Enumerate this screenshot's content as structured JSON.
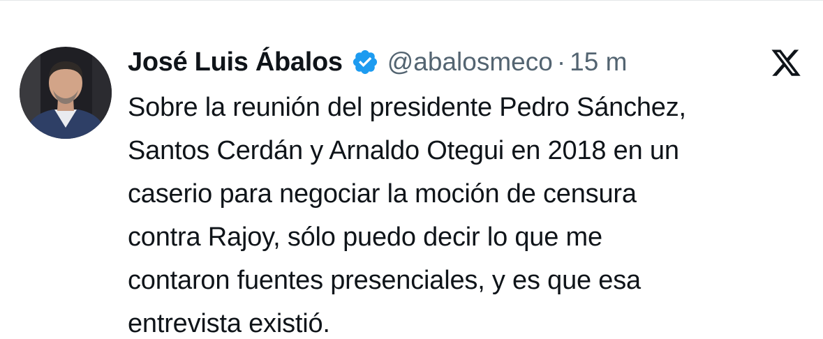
{
  "tweet": {
    "author_name": "José Luis Ábalos",
    "handle": "@abalosmeco",
    "separator": "·",
    "time": "15 m",
    "lines": [
      "Sobre la reunión del presidente Pedro Sánchez,",
      "Santos Cerdán y Arnaldo Otegui en 2018 en un",
      "caserio para negociar la moción de censura",
      "contra Rajoy, sólo puedo decir lo que me",
      "contaron fuentes presenciales, y es que esa",
      "entrevista existió."
    ]
  },
  "icons": {
    "verified": "verified-badge-icon",
    "logo": "x-logo-icon"
  },
  "colors": {
    "text": "#0f1419",
    "secondary": "#536471",
    "verified_blue": "#1d9bf0",
    "background": "#ffffff"
  }
}
